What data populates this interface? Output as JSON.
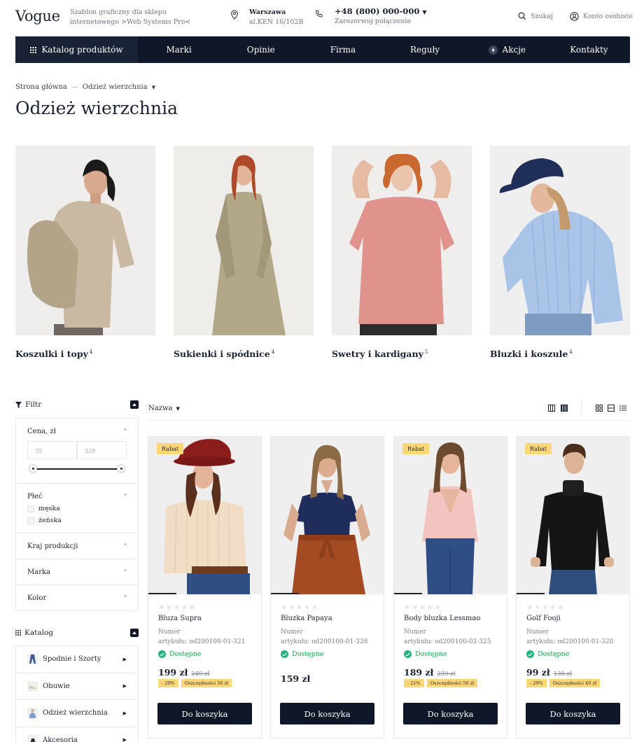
{
  "header": {
    "logo": "Vogue",
    "tagline": "Szablon graficzny dla sklepu internetowego >Web Systems Pro<",
    "city": "Warszawa",
    "address": "al.KEN 16/102B",
    "phone": "+48 (800) 000-000",
    "callback": "Zarezerwuj połączenie",
    "search": "Szukaj",
    "account": "Konto osobiste"
  },
  "nav": {
    "items": [
      "Katalog produktów",
      "Marki",
      "Opinie",
      "Firma",
      "Reguły",
      "Akcje",
      "Kontakty"
    ]
  },
  "breadcrumb": {
    "home": "Strona główna",
    "current": "Odzież wierzchnia"
  },
  "page_title": "Odzież wierzchnia",
  "categories": [
    {
      "label": "Koszulki i topy",
      "count": "4"
    },
    {
      "label": "Sukienki i spódnice",
      "count": "4"
    },
    {
      "label": "Swetry i kardigany",
      "count": "5"
    },
    {
      "label": "Bluzki i koszule",
      "count": "4"
    }
  ],
  "filter": {
    "title": "Filtr",
    "price_label": "Cena, zł",
    "price_min": "35",
    "price_max": "329",
    "gender_label": "Płeć",
    "gender_options": [
      "męska",
      "żeńska"
    ],
    "country_label": "Kraj produkcji",
    "brand_label": "Marka",
    "color_label": "Kolor"
  },
  "catalog": {
    "title": "Katalog",
    "items": [
      "Spodnie i Szorty",
      "Obuwie",
      "Odzież wierzchnia",
      "Akcesoria"
    ]
  },
  "toolbar": {
    "sort_label": "Nazwa"
  },
  "products": [
    {
      "badge": "Rabat",
      "name": "Bluza Supra",
      "number_label": "Numer",
      "article": "artykułu: od200100-01-321",
      "availability": "Dostępne",
      "price": "199 zł",
      "old_price": "249 zł",
      "discount": "- 20%",
      "savings": "Oszczędności 50 zł",
      "cart": "Do koszyka"
    },
    {
      "badge": "",
      "name": "Bluzka Papaya",
      "number_label": "Numer",
      "article": "artykułu: od200100-01-326",
      "availability": "Dostępne",
      "price": "159 zł",
      "old_price": "",
      "discount": "",
      "savings": "",
      "cart": "Do koszyka"
    },
    {
      "badge": "Rabat",
      "name": "Body bluzka Lessmao",
      "number_label": "Numer",
      "article": "artykułu: od200100-02-325",
      "availability": "Dostępne",
      "price": "189 zł",
      "old_price": "239 zł",
      "discount": "- 21%",
      "savings": "Oszczędności 50 zł",
      "cart": "Do koszyka"
    },
    {
      "badge": "Rabat",
      "name": "Golf Fooji",
      "number_label": "Numer",
      "article": "artykułu: od200100-01-320",
      "availability": "Dostępne",
      "price": "99 zł",
      "old_price": "139 zł",
      "discount": "- 29%",
      "savings": "Oszczędności 40 zł",
      "cart": "Do koszyka"
    }
  ],
  "colors": {
    "navy": "#0f1728",
    "badge": "#fcd77a",
    "available": "#1eb27c"
  }
}
